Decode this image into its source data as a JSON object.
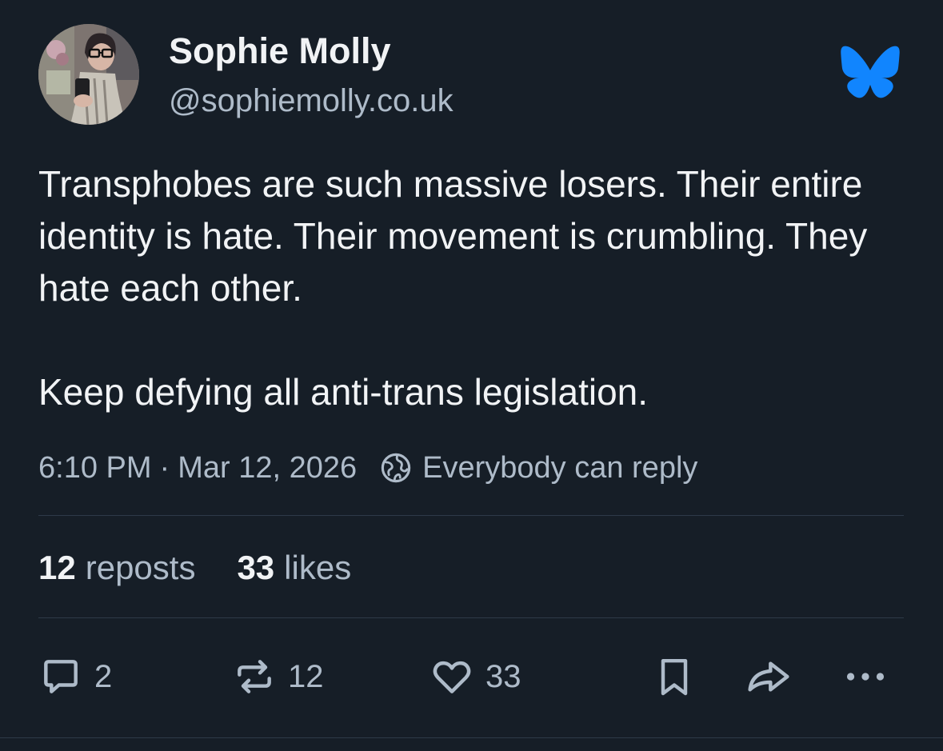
{
  "author": {
    "display_name": "Sophie Molly",
    "handle": "@sophiemolly.co.uk",
    "avatar_icon": "user-avatar-photo"
  },
  "brand": {
    "icon": "bluesky-butterfly-icon",
    "color": "#1185fe"
  },
  "post": {
    "text_line1": "Transphobes are such massive losers. Their entire identity is hate. Their movement is crumbling. They hate each other.",
    "text_line2": "Keep defying all anti-trans legislation."
  },
  "meta": {
    "time": "6:10 PM",
    "separator": "·",
    "date": "Mar 12, 2026",
    "reply_setting": "Everybody can reply",
    "reply_setting_icon": "globe-icon"
  },
  "stats": {
    "reposts_count": "12",
    "reposts_label": "reposts",
    "likes_count": "33",
    "likes_label": "likes"
  },
  "actions": {
    "reply_count": "2",
    "repost_count": "12",
    "like_count": "33"
  },
  "colors": {
    "background": "#161e27",
    "text_primary": "#f1f3f5",
    "text_secondary": "#aebbc9",
    "divider": "#2e3a48"
  }
}
